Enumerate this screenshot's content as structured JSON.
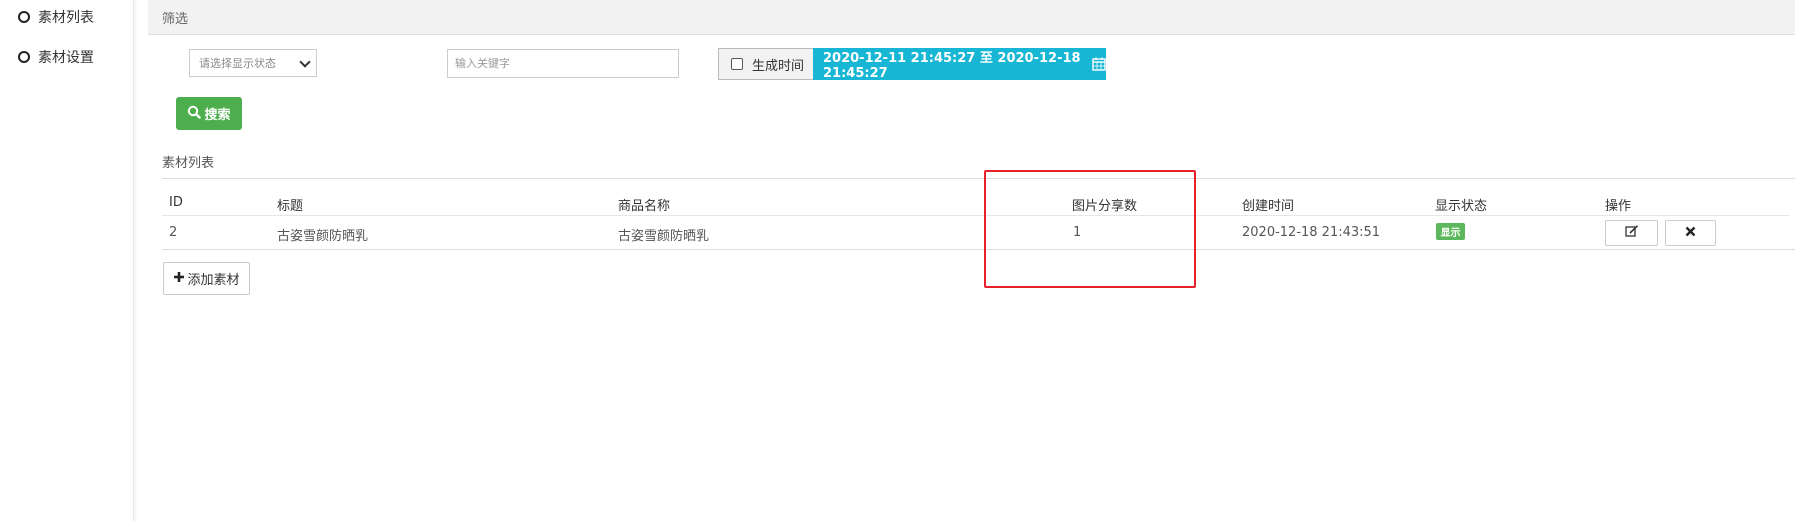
{
  "sidebar": {
    "items": [
      {
        "label": "素材列表"
      },
      {
        "label": "素材设置"
      }
    ]
  },
  "filter": {
    "header_label": "筛选",
    "status_select_value": "请选择显示状态",
    "keyword_placeholder": "输入关键字",
    "gen_time_label": "生成时间",
    "date_range_value": "2020-12-11 21:45:27 至 2020-12-18 21:45:27",
    "search_label": "搜索"
  },
  "list": {
    "title": "素材列表",
    "columns": [
      "ID",
      "标题",
      "商品名称",
      "图片分享数",
      "创建时间",
      "显示状态",
      "操作"
    ],
    "rows": [
      {
        "id": "2",
        "title": "古姿雪颜防晒乳",
        "product": "古姿雪颜防晒乳",
        "share_count": "1",
        "created": "2020-12-18 21:43:51",
        "status": "显示"
      }
    ],
    "add_label": "添加素材"
  },
  "colors": {
    "accent_cyan": "#17b6d4",
    "success_green": "#4cae4c",
    "highlight_red": "#e8202a"
  },
  "icons": {
    "search": "search-icon",
    "calendar": "calendar-icon",
    "edit": "edit-icon",
    "delete": "close-icon",
    "add": "plus-icon"
  }
}
